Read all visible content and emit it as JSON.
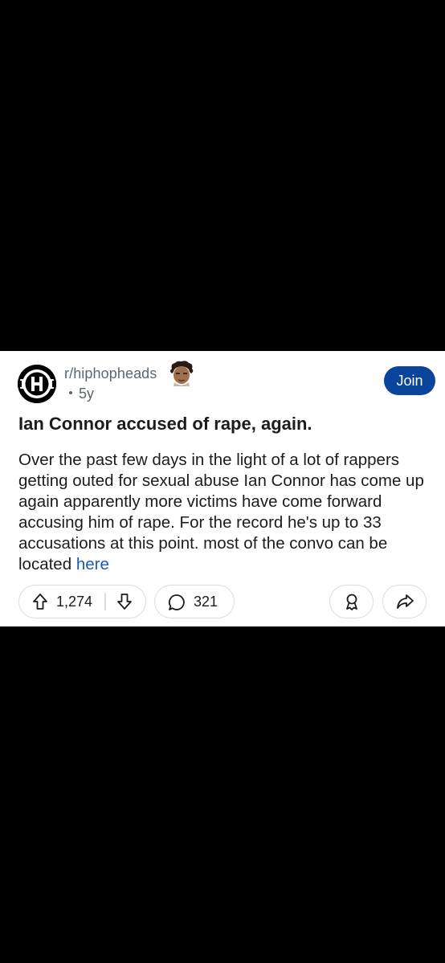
{
  "post": {
    "subreddit": "r/hiphopheads",
    "age": "5y",
    "join_label": "Join",
    "title": "Ian Connor accused of rape, again.",
    "body_text": "Over the past few days in the light of a lot of rappers getting outed for sexual abuse Ian Connor has come up again apparently more victims have come forward accusing him of rape. For the record he's up to 33 accusations at this point. most of the convo can be located ",
    "body_link": "here",
    "upvotes": "1,274",
    "comments": "321"
  },
  "icons": {
    "subreddit": "subreddit-logo-icon",
    "flair": "user-flair-avatar-icon",
    "upvote": "arrow-up-icon",
    "downvote": "arrow-down-icon",
    "comment": "speech-bubble-icon",
    "award": "award-ribbon-icon",
    "share": "share-arrow-icon"
  },
  "colors": {
    "join_button": "#0a449b",
    "link": "#1b5ab9",
    "meta_text": "#5c6770",
    "background": "#000000",
    "card": "#ffffff"
  }
}
